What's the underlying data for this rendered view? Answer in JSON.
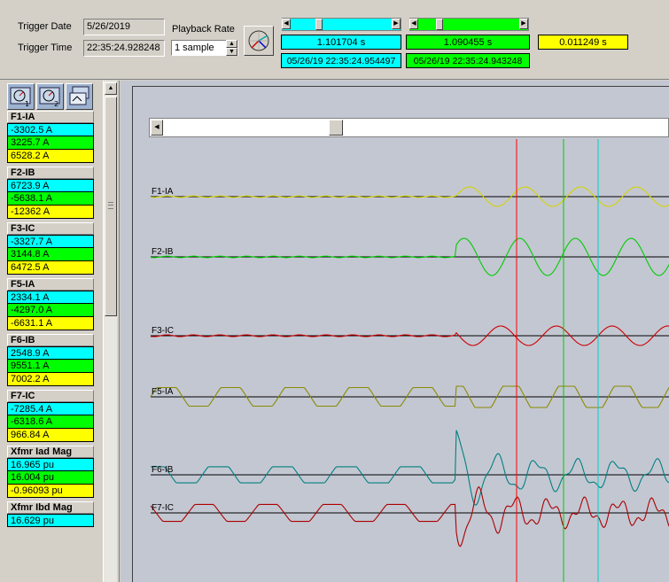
{
  "header": {
    "trigger_date_label": "Trigger Date",
    "trigger_date_value": "5/26/2019",
    "trigger_time_label": "Trigger Time",
    "trigger_time_value": "22:35:24.928248",
    "playback_rate_label": "Playback Rate",
    "playback_rate_value": "1 sample"
  },
  "cursors": {
    "cursor1": {
      "time": "1.101704 s",
      "timestamp": "05/26/19 22:35:24.954497",
      "color": "#00ffff"
    },
    "cursor2": {
      "time": "1.090455 s",
      "timestamp": "05/26/19 22:35:24.943248",
      "color": "#00ff00"
    },
    "delta": {
      "time": "0.011249 s",
      "color": "#ffff00"
    }
  },
  "channels": [
    {
      "name": "F1-IA",
      "values": [
        "-3302.5 A",
        "3225.7 A",
        "6528.2 A"
      ]
    },
    {
      "name": "F2-IB",
      "values": [
        "6723.9 A",
        "-5638.1 A",
        "-12362 A"
      ]
    },
    {
      "name": "F3-IC",
      "values": [
        "-3327.7 A",
        "3144.8 A",
        "6472.5 A"
      ]
    },
    {
      "name": "F5-IA",
      "values": [
        "2334.1 A",
        "-4297.0 A",
        "-6631.1 A"
      ]
    },
    {
      "name": "F6-IB",
      "values": [
        "2548.9 A",
        "9551.1 A",
        "7002.2 A"
      ]
    },
    {
      "name": "F7-IC",
      "values": [
        "-7285.4 A",
        "-6318.6 A",
        "966.84 A"
      ]
    },
    {
      "name": "Xfmr Iad Mag",
      "values": [
        "16.965 pu",
        "16.004 pu",
        "-0.96093 pu"
      ]
    },
    {
      "name": "Xfmr Ibd Mag",
      "values": [
        "16.629 pu"
      ]
    }
  ],
  "traces": [
    {
      "label": "F1-IA",
      "color": "#d4d400"
    },
    {
      "label": "F2-IB",
      "color": "#00cc00"
    },
    {
      "label": "F3-IC",
      "color": "#cc0000"
    },
    {
      "label": "F5-IA",
      "color": "#8a8a00"
    },
    {
      "label": "F6-IB",
      "color": "#008080"
    },
    {
      "label": "F7-IC",
      "color": "#aa0000"
    }
  ],
  "cursor_lines": {
    "red": "#ff0000",
    "green": "#00cc00",
    "cyan": "#00cccc"
  },
  "icons": {
    "playback": "polar-meter-icon",
    "view1": "view-1-icon",
    "view2": "view-2-icon",
    "view3": "view-3-icon"
  }
}
